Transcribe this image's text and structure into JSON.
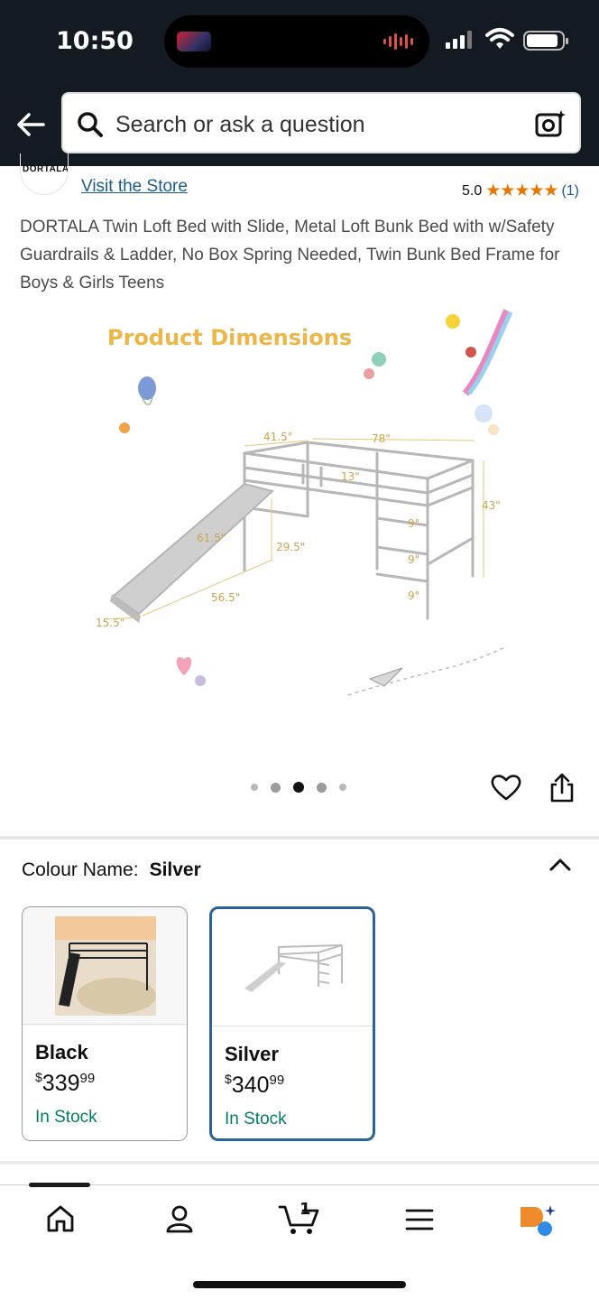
{
  "status": {
    "time": "10:50"
  },
  "search": {
    "placeholder": "Search or ask a question"
  },
  "store": {
    "brand_logo_text": "DORTALA",
    "visit_link": "Visit the Store"
  },
  "rating": {
    "score": "5.0",
    "stars": "★★★★★",
    "count": "(1)"
  },
  "product": {
    "title": "DORTALA Twin Loft Bed with Slide, Metal Loft Bunk Bed with w/Safety Guardrails & Ladder, No Box Spring Needed, Twin Bunk Bed Frame for Boys & Girls Teens"
  },
  "image": {
    "heading": "Product Dimensions",
    "dimensions": [
      "41.5\"",
      "78\"",
      "13\"",
      "43\"",
      "9\"",
      "9\"",
      "9\"",
      "61.5\"",
      "29.5\"",
      "56.5\"",
      "15.5\""
    ],
    "carousel_dots": 5,
    "active_dot": 3
  },
  "colour": {
    "label": "Colour Name:",
    "selected": "Silver",
    "options": [
      {
        "name": "Black",
        "price_dollars": "339",
        "price_cents": "99",
        "currency": "$",
        "stock": "In Stock",
        "selected": false
      },
      {
        "name": "Silver",
        "price_dollars": "340",
        "price_cents": "99",
        "currency": "$",
        "stock": "In Stock",
        "selected": true
      }
    ]
  },
  "nav": {
    "items": [
      "home-icon",
      "account-icon",
      "cart-icon",
      "menu-icon",
      "rufus-assistant-icon"
    ],
    "cart_count": "1"
  },
  "colors": {
    "header_bg": "#131a22",
    "link": "#1a5d8c",
    "star": "#e77600",
    "in_stock": "#067d62",
    "selected_border": "#2a6496"
  }
}
